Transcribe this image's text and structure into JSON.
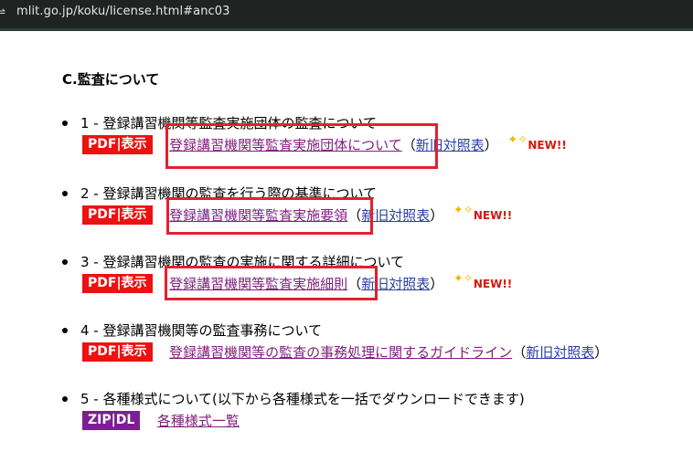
{
  "browser": {
    "url": "mlit.go.jp/koku/license.html#anc03"
  },
  "section": {
    "title": "C.監査について"
  },
  "items": [
    {
      "heading": "1 - 登録講習機関等監査実施団体の監査について",
      "badge": "PDF|表示",
      "link": "登録講習機関等監査実施団体について",
      "compare_open": "（",
      "compare": "新旧対照表",
      "compare_close": "）",
      "new_label": "NEW!!"
    },
    {
      "heading": "2 - 登録講習機関の監査を行う際の基準について",
      "badge": "PDF|表示",
      "link": "登録講習機関等監査実施要領",
      "compare_open": "（",
      "compare": "新旧対照表",
      "compare_close": "）",
      "new_label": "NEW!!"
    },
    {
      "heading": "3 - 登録講習機関の監査の実施に関する詳細について",
      "badge": "PDF|表示",
      "link": "登録講習機関等監査実施細則",
      "compare_open": "（",
      "compare": "新旧対照表",
      "compare_close": "）",
      "new_label": "NEW!!"
    },
    {
      "heading": "4 - 登録講習機関等の監査事務について",
      "badge": "PDF|表示",
      "link": "登録講習機関等の監査の事務処理に関するガイドライン",
      "compare_open": "（",
      "compare": "新旧対照表",
      "compare_close": "）"
    },
    {
      "heading": "5 - 各種様式について(以下から各種様式を一括でダウンロードできます)",
      "badge": "ZIP|DL",
      "link": "各種様式一覧"
    }
  ],
  "colors": {
    "pdf_badge": "#ee1111",
    "zip_badge": "#7d1f93",
    "highlight": "#e3202f",
    "link": "#2b3fa3",
    "new": "#d4180f"
  },
  "icons": {
    "new_icon": "sparkle-icon"
  }
}
